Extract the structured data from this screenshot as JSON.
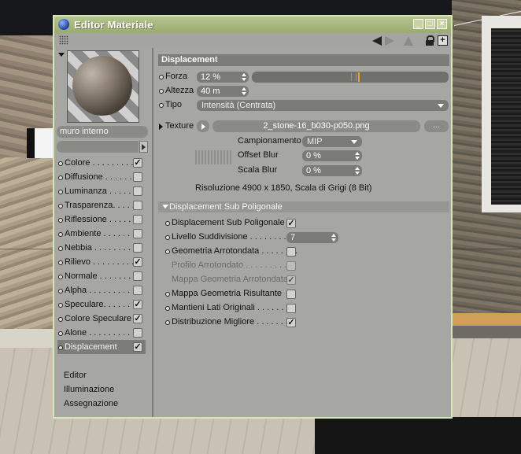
{
  "window": {
    "title": "Editor Materiale",
    "buttons": {
      "minimize": "_",
      "maximize": "□",
      "close": "×"
    },
    "toolbar": {
      "new_window": "+"
    }
  },
  "material": {
    "name": "muro interno"
  },
  "channels": [
    {
      "label": "Colore . . . . . . . . .",
      "checked": "✓"
    },
    {
      "label": "Diffusione . . . . . . .",
      "checked": ""
    },
    {
      "label": "Luminanza . . . . . .",
      "checked": ""
    },
    {
      "label": "Trasparenza. . . . . .",
      "checked": ""
    },
    {
      "label": "Riflessione . . . . . .",
      "checked": ""
    },
    {
      "label": "Ambiente . . . . . . .",
      "checked": ""
    },
    {
      "label": "Nebbia . . . . . . . . .",
      "checked": ""
    },
    {
      "label": "Rilievo . . . . . . . . .",
      "checked": "✓"
    },
    {
      "label": "Normale . . . . . . . .",
      "checked": ""
    },
    {
      "label": "Alpha . . . . . . . . . .",
      "checked": ""
    },
    {
      "label": "Speculare. . . . . . . .",
      "checked": "✓"
    },
    {
      "label": "Colore Speculare",
      "checked": "✓"
    },
    {
      "label": "Alone . . . . . . . . . .",
      "checked": ""
    },
    {
      "label": "Displacement",
      "checked": "✓"
    }
  ],
  "extra_items": [
    "Editor",
    "Illuminazione",
    "Assegnazione"
  ],
  "displacement": {
    "section_title": "Displacement",
    "forza_label": "Forza",
    "forza_value": "12 %",
    "forza_fraction": 0.12,
    "altezza_label": "Altezza",
    "altezza_value": "40 m",
    "tipo_label": "Tipo",
    "tipo_value": "Intensità (Centrata)",
    "texture_label": "Texture",
    "texture_file": "2_stone-16_b030-p050.png",
    "texture_more": "...",
    "campionamento_label": "Campionamento",
    "campionamento_value": "MIP",
    "offset_blur_label": "Offset Blur",
    "offset_blur_value": "0 %",
    "scala_blur_label": "Scala Blur",
    "scala_blur_value": "0 %",
    "resolution_text": "Risoluzione 4900 x 1850, Scala di Grigi (8 Bit)"
  },
  "subpoly": {
    "section_title": "Displacement Sub Poligonale",
    "items": [
      {
        "label": "Displacement Sub Poligonale",
        "checked": "✓",
        "dot": true,
        "disabled": false
      },
      {
        "label": "Livello Suddivisione . . . . . . . . .",
        "value": "7",
        "dot": true,
        "disabled": false
      },
      {
        "label": "Geometria Arrotondata . . . . . . . .",
        "checked": "",
        "dot": true,
        "disabled": false
      },
      {
        "label": "Profilo Arrotondato . . . . . . . . . .",
        "checked": "",
        "dot": false,
        "disabled": true
      },
      {
        "label": "Mappa Geometria Arrotondata",
        "checked": "✓",
        "dot": false,
        "disabled": true
      },
      {
        "label": "Mappa Geometria Risultante",
        "checked": "",
        "dot": true,
        "disabled": false
      },
      {
        "label": "Mantieni Lati Originali . . . . . . . .",
        "checked": "",
        "dot": true,
        "disabled": false
      },
      {
        "label": "Distribuzione Migliore . . . . . . . .",
        "checked": "✓",
        "dot": true,
        "disabled": false
      }
    ]
  },
  "colors": {
    "title_bar": "#9aab6f",
    "panel": "#a6a6a3",
    "section": "#7c7c79",
    "slider_knob": "#f0a020"
  },
  "icons": [
    "app-sphere-icon",
    "grip-icon",
    "nav-back-icon",
    "nav-forward-icon",
    "nav-up-icon",
    "lock-icon",
    "new-window-icon",
    "checkmark-icon",
    "play-icon",
    "caret-down-icon"
  ]
}
